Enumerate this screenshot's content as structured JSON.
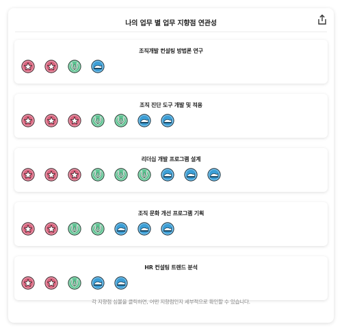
{
  "header": {
    "title": "나의 업무 별 업무 지향점 연관성",
    "share_icon": "share-icon"
  },
  "colors": {
    "star": "#d9647e",
    "seed": "#5bc290",
    "wave": "#3b9ed6"
  },
  "cards": [
    {
      "title": "조직개발 컨설팅 방법론 연구",
      "badges": [
        "star",
        "star",
        "seed",
        "wave"
      ]
    },
    {
      "title": "조직 진단 도구 개발 및 적용",
      "badges": [
        "star",
        "star",
        "star",
        "seed",
        "seed",
        "wave",
        "wave"
      ]
    },
    {
      "title": "리더십 개발 프로그램 설계",
      "badges": [
        "star",
        "star",
        "star",
        "seed",
        "seed",
        "seed",
        "wave",
        "wave",
        "wave"
      ]
    },
    {
      "title": "조직 문화 개선 프로그램 기획",
      "badges": [
        "star",
        "star",
        "seed",
        "seed",
        "wave",
        "wave",
        "wave"
      ]
    },
    {
      "title": "HR 컨설팅 트렌드 분석",
      "badges": [
        "star",
        "star",
        "seed",
        "wave",
        "wave"
      ]
    }
  ],
  "footer": {
    "hint": "각 지향점 심볼을 클릭하면, 어떤 지향점인지 세부적으로 확인할 수 있습니다."
  }
}
